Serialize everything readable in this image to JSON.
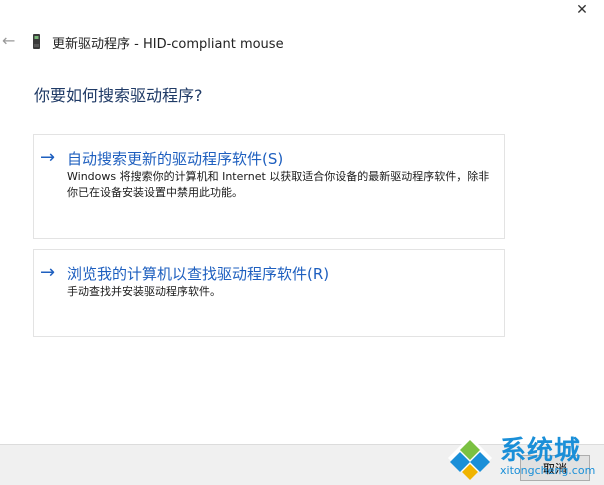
{
  "window": {
    "close_glyph": "✕",
    "title": "更新驱动程序 - HID-compliant mouse"
  },
  "heading": "你要如何搜索驱动程序?",
  "options": [
    {
      "arrow": "→",
      "title": "自动搜索更新的驱动程序软件(S)",
      "description": "Windows 将搜索你的计算机和 Internet 以获取适合你设备的最新驱动程序软件，除非你已在设备安装设置中禁用此功能。"
    },
    {
      "arrow": "→",
      "title": "浏览我的计算机以查找驱动程序软件(R)",
      "description": "手动查找并安装驱动程序软件。"
    }
  ],
  "footer": {
    "cancel_label": "取消"
  },
  "watermark": {
    "title": "系统城",
    "url": "xitongcheng.com"
  },
  "colors": {
    "accent": "#1e5fbf",
    "heading": "#1f3a66",
    "watermark": "#1a8fd8"
  },
  "icons": {
    "back": "arrow-left-icon",
    "device": "mouse-device-icon",
    "option_arrow": "arrow-right-icon",
    "close": "close-icon"
  }
}
